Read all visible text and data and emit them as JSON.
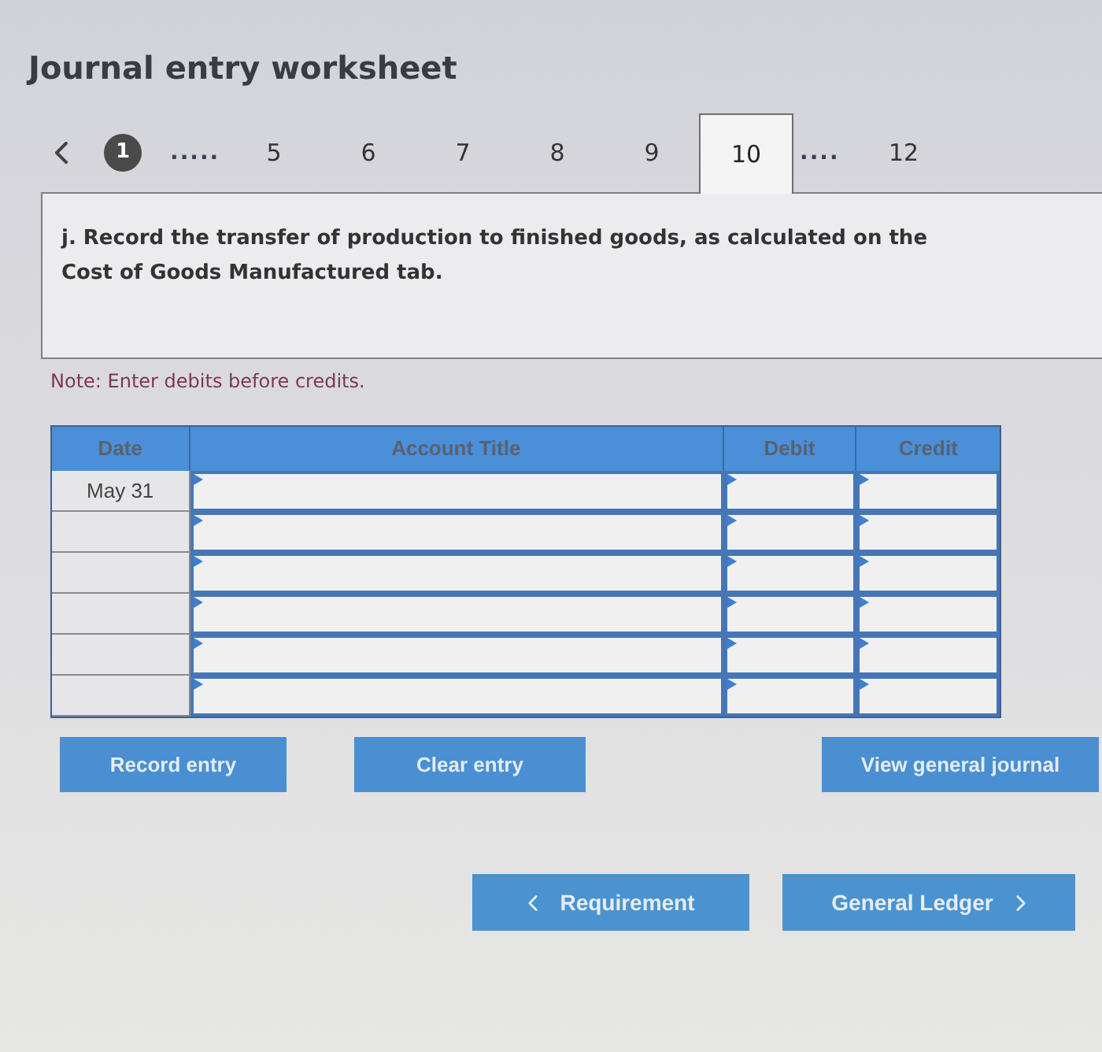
{
  "title": "Journal entry worksheet",
  "pagination": {
    "items": [
      {
        "label": "1",
        "kind": "circle",
        "selected": false
      },
      {
        "label": ".....",
        "kind": "ellipsis",
        "selected": false
      },
      {
        "label": "5",
        "kind": "number",
        "selected": false
      },
      {
        "label": "6",
        "kind": "number",
        "selected": false
      },
      {
        "label": "7",
        "kind": "number",
        "selected": false
      },
      {
        "label": "8",
        "kind": "number",
        "selected": false
      },
      {
        "label": "9",
        "kind": "number",
        "selected": false
      },
      {
        "label": "10",
        "kind": "number",
        "selected": true
      },
      {
        "label": "....",
        "kind": "ellipsis",
        "selected": false
      },
      {
        "label": "12",
        "kind": "number",
        "selected": false
      }
    ]
  },
  "question": {
    "text": "j. Record the transfer of production to finished goods, as calculated on the Cost of Goods Manufactured tab."
  },
  "note": "Note: Enter debits before credits.",
  "journal_table": {
    "columns": [
      "Date",
      "Account Title",
      "Debit",
      "Credit"
    ],
    "rows": [
      {
        "date": "May 31"
      },
      {},
      {},
      {},
      {},
      {}
    ]
  },
  "entry_buttons": [
    "Record entry",
    "Clear entry",
    "View general journal"
  ],
  "navigation": [
    {
      "label": "Requirement",
      "kind": "prev"
    },
    {
      "label": "General Ledger",
      "kind": "next"
    }
  ]
}
